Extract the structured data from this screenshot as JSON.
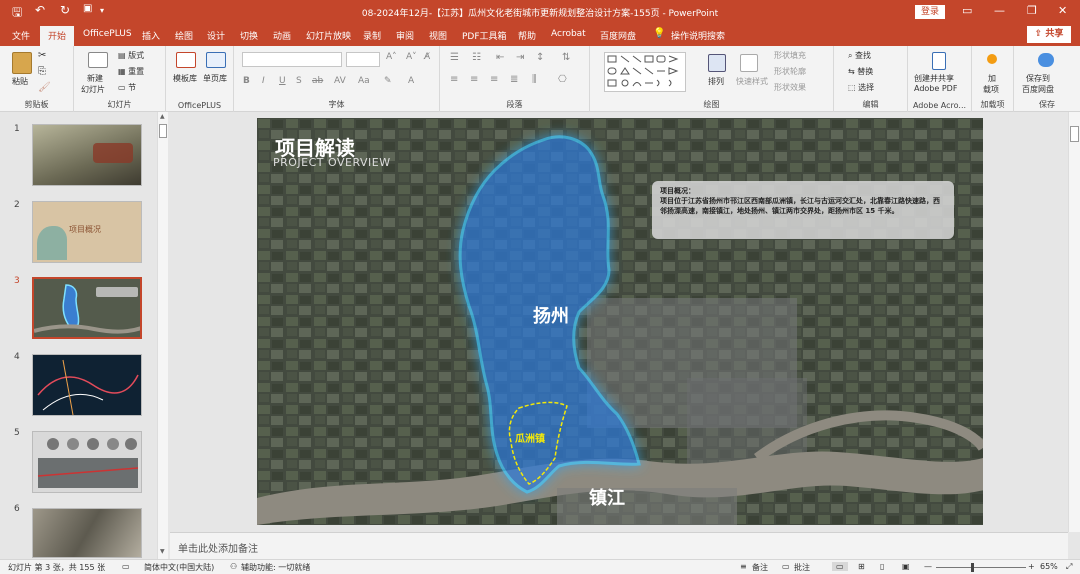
{
  "window": {
    "title": "08-2024年12月-【江苏】瓜州文化老街城市更新规划整治设计方案-155页  -  PowerPoint",
    "login_label": "登录",
    "share_label": "共享"
  },
  "tabs": [
    "文件",
    "开始",
    "OfficePLUS",
    "插入",
    "绘图",
    "设计",
    "切换",
    "动画",
    "幻灯片放映",
    "录制",
    "审阅",
    "视图",
    "PDF工具箱",
    "帮助",
    "Acrobat",
    "百度网盘",
    "操作说明搜索"
  ],
  "ribbon": {
    "clipboard": {
      "paste": "粘贴",
      "label": "剪贴板"
    },
    "slides": {
      "new_slide": "新建",
      "new_slide2": "幻灯片",
      "layout": "版式",
      "reset": "重置",
      "section": "节",
      "label": "幻灯片"
    },
    "officeplus": {
      "template": "模板库",
      "single": "单页库",
      "label": "OfficePLUS"
    },
    "font": {
      "label": "字体"
    },
    "paragraph": {
      "label": "段落"
    },
    "drawing": {
      "arrange": "排列",
      "quick_style": "快速样式",
      "fill": "形状填充",
      "outline": "形状轮廓",
      "effect": "形状效果",
      "label": "绘图"
    },
    "editing": {
      "find": "查找",
      "replace": "替换",
      "select": "选择",
      "label": "编辑"
    },
    "adobe": {
      "create1": "创建并共享",
      "create2": "Adobe PDF",
      "label": "Adobe Acro..."
    },
    "addins": {
      "add1": "加",
      "add2": "载项",
      "label": "加载项"
    },
    "save": {
      "save1": "保存到",
      "save2": "百度网盘",
      "label": "保存"
    }
  },
  "slides_panel": {
    "numbers": [
      "1",
      "2",
      "3",
      "4",
      "5",
      "6"
    ],
    "selected": "3",
    "thumb2_title": "项目概况"
  },
  "slide": {
    "title": "项目解读",
    "subtitle": "PROJECT OVERVIEW",
    "info_title": "项目概况：",
    "info_body": "项目位于江苏省扬州市邗江区西南部瓜洲镇，长江与古运河交汇处，北靠春江路快速路，西邻扬溧高速，南接镇江，地处扬州、镇江两市交界处，距扬州市区 15 千米。",
    "label_yangzhou": "扬州",
    "label_guazhou": "瓜洲镇",
    "label_zhenjiang": "镇江"
  },
  "notes_placeholder": "单击此处添加备注",
  "status": {
    "slide_info": "幻灯片 第 3 张，共 155 张",
    "language": "简体中文(中国大陆)",
    "accessibility": "辅助功能: 一切就绪",
    "notes": "备注",
    "comments": "批注",
    "zoom": "65%"
  },
  "colors": {
    "accent": "#c4462b",
    "glow": "#3fc8ff",
    "guazhou": "#f2e80a"
  }
}
